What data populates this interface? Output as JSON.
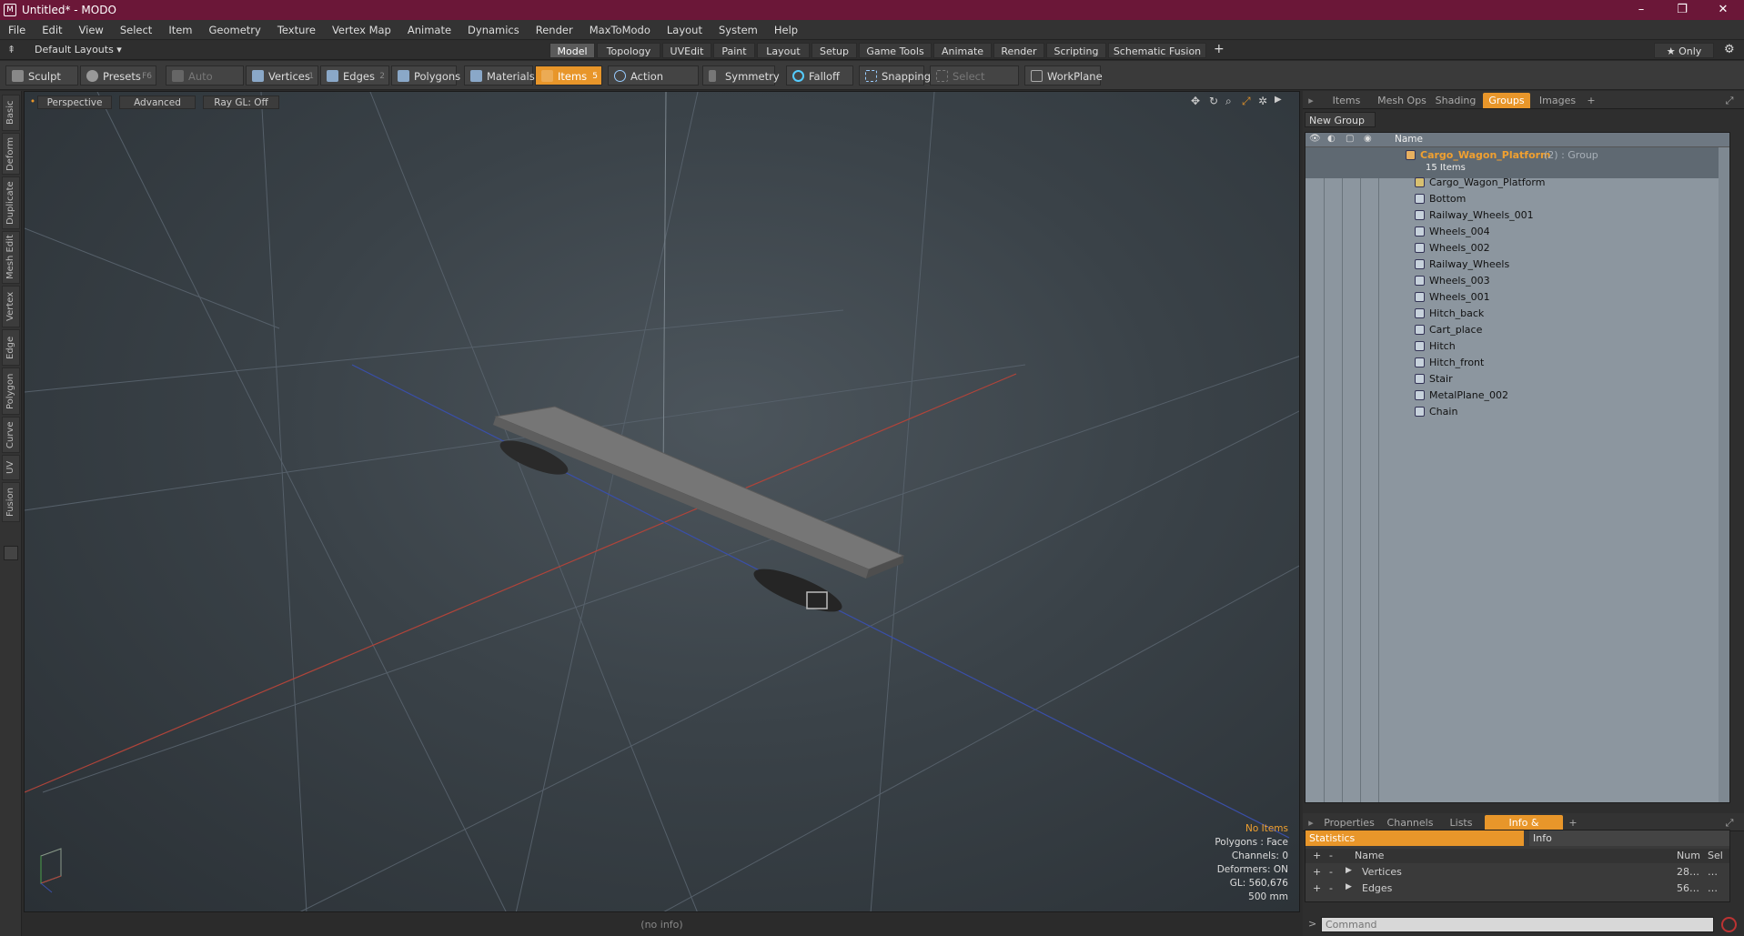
{
  "window": {
    "title": "Untitled* - MODO",
    "logo_letter": "M",
    "minimize": "–",
    "maximize": "❐",
    "close": "✕"
  },
  "menu": [
    "File",
    "Edit",
    "View",
    "Select",
    "Item",
    "Geometry",
    "Texture",
    "Vertex Map",
    "Animate",
    "Dynamics",
    "Render",
    "MaxToModo",
    "Layout",
    "System",
    "Help"
  ],
  "layoutbar": {
    "layout_dropdown": "Default Layouts ▾",
    "tabs": [
      "Model",
      "Topology",
      "UVEdit",
      "Paint",
      "Layout",
      "Setup",
      "Game Tools",
      "Animate",
      "Render",
      "Scripting",
      "Schematic Fusion"
    ],
    "active_tab": "Model",
    "add": "+",
    "only": "★  Only",
    "gear": "⚙"
  },
  "toolbar": {
    "sculpt": "Sculpt",
    "presets": "Presets",
    "presets_key": "F6",
    "auto_select": "Auto Select",
    "vertices": "Vertices",
    "vertices_key": "1",
    "edges": "Edges",
    "edges_key": "2",
    "polygons": "Polygons",
    "materials": "Materials",
    "items": "Items",
    "items_key": "5",
    "action_center": "Action Center",
    "symmetry": "Symmetry",
    "falloff": "Falloff",
    "snapping": "Snapping",
    "select_through": "Select Through",
    "workplane": "WorkPlane"
  },
  "left_tabs": [
    "Basic",
    "Deform",
    "Duplicate",
    "Mesh Edit",
    "Vertex",
    "Edge",
    "Polygon",
    "Curve",
    "UV",
    "Fusion"
  ],
  "viewport": {
    "perspective": "Perspective",
    "advanced": "Advanced",
    "raygl": "Ray GL: Off",
    "info": {
      "no_items": "No Items",
      "polygons": "Polygons : Face",
      "channels": "Channels: 0",
      "deformers": "Deformers: ON",
      "gl": "GL: 560,676",
      "size": "500 mm"
    }
  },
  "status": "(no info)",
  "right_top_tabs": [
    "Items",
    "Mesh Ops",
    "Shading",
    "Groups",
    "Images",
    "+"
  ],
  "right_top_active": "Groups",
  "groups": {
    "new_group": "New Group",
    "column_name": "Name",
    "root": {
      "name": "Cargo_Wagon_Platform",
      "suffix": " (2) : Group",
      "count": "15 Items"
    },
    "children": [
      "Cargo_Wagon_Platform",
      "Bottom",
      "Railway_Wheels_001",
      "Wheels_004",
      "Wheels_002",
      "Railway_Wheels",
      "Wheels_003",
      "Wheels_001",
      "Hitch_back",
      "Cart_place",
      "Hitch",
      "Hitch_front",
      "Stair",
      "MetalPlane_002",
      "Chain"
    ]
  },
  "right_bottom_tabs": [
    "Properties",
    "Channels",
    "Lists",
    "Info & Statistics",
    "+"
  ],
  "right_bottom_active": "Info & Statistics",
  "stats": {
    "statistics_tab": "Statistics",
    "info_tab": "Info",
    "col_name": "Name",
    "col_num": "Num",
    "col_sel": "Sel",
    "rows": [
      {
        "name": "Vertices",
        "num": "28…",
        "sel": "…"
      },
      {
        "name": "Edges",
        "num": "56…",
        "sel": "…"
      }
    ]
  },
  "command": {
    "placeholder": "Command",
    "prompt": ">"
  },
  "colors": {
    "titlebar": "#6b1738",
    "accent": "#e8962a",
    "group_root": "#f0a030"
  }
}
